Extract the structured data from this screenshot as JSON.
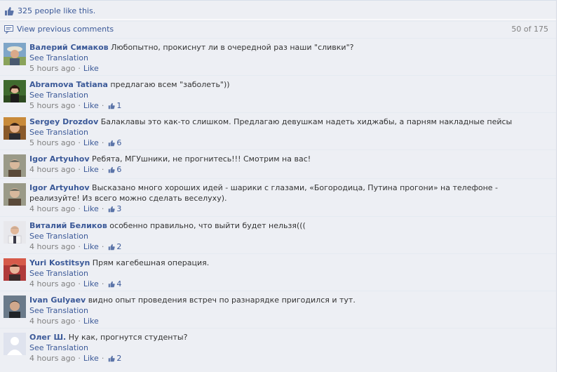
{
  "likes": {
    "text": "325 people like this."
  },
  "previous": {
    "label": "View previous comments",
    "count": "50 of 175"
  },
  "comments": [
    {
      "author": "Валерий Симаков",
      "text": "Любопытно, прокиснут ли в очередной раз наши \"сливки\"?",
      "see": "See Translation",
      "time": "5 hours ago",
      "like": "Like",
      "likes": ""
    },
    {
      "author": "Abramova Tatiana",
      "text": "предлагаю всем \"заболеть\"))",
      "see": "See Translation",
      "time": "5 hours ago",
      "like": "Like",
      "likes": "1"
    },
    {
      "author": "Sergey Drozdov",
      "text": "Балаклавы это как-то слишком. Предлагаю девушкам надеть хиджабы, а парням накладные пейсы",
      "see": "See Translation",
      "time": "5 hours ago",
      "like": "Like",
      "likes": "6"
    },
    {
      "author": "Igor Artyuhov",
      "text": "Ребята, МГУшники, не прогнитесь!!! Смотрим на вас!",
      "see": "",
      "time": "4 hours ago",
      "like": "Like",
      "likes": "6"
    },
    {
      "author": "Igor Artyuhov",
      "text": "Высказано много хороших идей - шарики с глазами, «Богородица, Путина прогони» на телефоне - реализуйте! Из всего можно сделать веселуху).",
      "see": "",
      "time": "4 hours ago",
      "like": "Like",
      "likes": "3"
    },
    {
      "author": "Виталий Беликов",
      "text": "особенно правильно, что выйти будет нельзя(((",
      "see": "See Translation",
      "time": "4 hours ago",
      "like": "Like",
      "likes": "2"
    },
    {
      "author": "Yuri Kostitsyn",
      "text": "Прям кагебешная операция.",
      "see": "See Translation",
      "time": "4 hours ago",
      "like": "Like",
      "likes": "4"
    },
    {
      "author": "Ivan Gulyaev",
      "text": "видно опыт проведения встреч по разнарядке пригодился и тут.",
      "see": "See Translation",
      "time": "4 hours ago",
      "like": "Like",
      "likes": ""
    },
    {
      "author": "Олег Ш.",
      "text": "Ну как, прогнутся студенты?",
      "see": "See Translation",
      "time": "4 hours ago",
      "like": "Like",
      "likes": "2"
    }
  ],
  "sep": "·",
  "colors": {
    "link": "#3b5998",
    "background": "#edeff4",
    "meta": "#808080"
  }
}
